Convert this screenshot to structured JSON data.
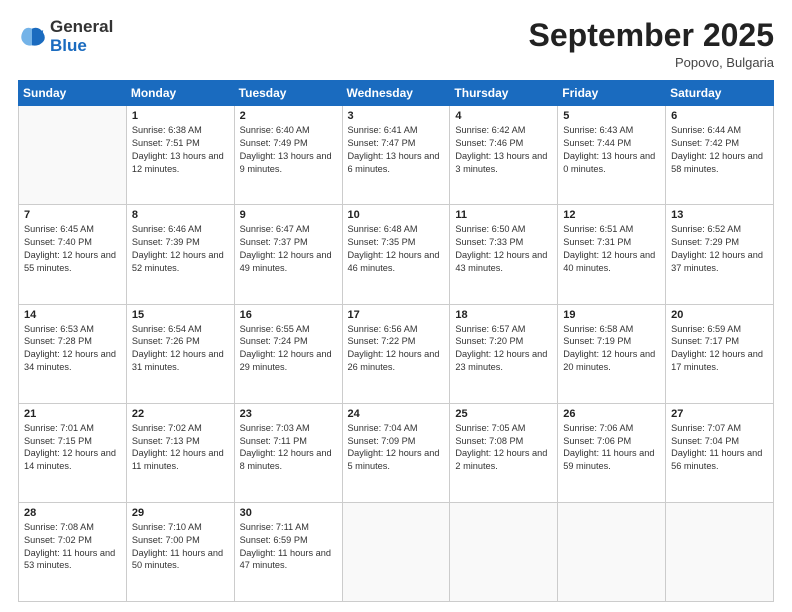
{
  "header": {
    "logo_general": "General",
    "logo_blue": "Blue",
    "month_title": "September 2025",
    "location": "Popovo, Bulgaria"
  },
  "columns": [
    "Sunday",
    "Monday",
    "Tuesday",
    "Wednesday",
    "Thursday",
    "Friday",
    "Saturday"
  ],
  "weeks": [
    [
      {
        "day": "",
        "sunrise": "",
        "sunset": "",
        "daylight": ""
      },
      {
        "day": "1",
        "sunrise": "Sunrise: 6:38 AM",
        "sunset": "Sunset: 7:51 PM",
        "daylight": "Daylight: 13 hours and 12 minutes."
      },
      {
        "day": "2",
        "sunrise": "Sunrise: 6:40 AM",
        "sunset": "Sunset: 7:49 PM",
        "daylight": "Daylight: 13 hours and 9 minutes."
      },
      {
        "day": "3",
        "sunrise": "Sunrise: 6:41 AM",
        "sunset": "Sunset: 7:47 PM",
        "daylight": "Daylight: 13 hours and 6 minutes."
      },
      {
        "day": "4",
        "sunrise": "Sunrise: 6:42 AM",
        "sunset": "Sunset: 7:46 PM",
        "daylight": "Daylight: 13 hours and 3 minutes."
      },
      {
        "day": "5",
        "sunrise": "Sunrise: 6:43 AM",
        "sunset": "Sunset: 7:44 PM",
        "daylight": "Daylight: 13 hours and 0 minutes."
      },
      {
        "day": "6",
        "sunrise": "Sunrise: 6:44 AM",
        "sunset": "Sunset: 7:42 PM",
        "daylight": "Daylight: 12 hours and 58 minutes."
      }
    ],
    [
      {
        "day": "7",
        "sunrise": "Sunrise: 6:45 AM",
        "sunset": "Sunset: 7:40 PM",
        "daylight": "Daylight: 12 hours and 55 minutes."
      },
      {
        "day": "8",
        "sunrise": "Sunrise: 6:46 AM",
        "sunset": "Sunset: 7:39 PM",
        "daylight": "Daylight: 12 hours and 52 minutes."
      },
      {
        "day": "9",
        "sunrise": "Sunrise: 6:47 AM",
        "sunset": "Sunset: 7:37 PM",
        "daylight": "Daylight: 12 hours and 49 minutes."
      },
      {
        "day": "10",
        "sunrise": "Sunrise: 6:48 AM",
        "sunset": "Sunset: 7:35 PM",
        "daylight": "Daylight: 12 hours and 46 minutes."
      },
      {
        "day": "11",
        "sunrise": "Sunrise: 6:50 AM",
        "sunset": "Sunset: 7:33 PM",
        "daylight": "Daylight: 12 hours and 43 minutes."
      },
      {
        "day": "12",
        "sunrise": "Sunrise: 6:51 AM",
        "sunset": "Sunset: 7:31 PM",
        "daylight": "Daylight: 12 hours and 40 minutes."
      },
      {
        "day": "13",
        "sunrise": "Sunrise: 6:52 AM",
        "sunset": "Sunset: 7:29 PM",
        "daylight": "Daylight: 12 hours and 37 minutes."
      }
    ],
    [
      {
        "day": "14",
        "sunrise": "Sunrise: 6:53 AM",
        "sunset": "Sunset: 7:28 PM",
        "daylight": "Daylight: 12 hours and 34 minutes."
      },
      {
        "day": "15",
        "sunrise": "Sunrise: 6:54 AM",
        "sunset": "Sunset: 7:26 PM",
        "daylight": "Daylight: 12 hours and 31 minutes."
      },
      {
        "day": "16",
        "sunrise": "Sunrise: 6:55 AM",
        "sunset": "Sunset: 7:24 PM",
        "daylight": "Daylight: 12 hours and 29 minutes."
      },
      {
        "day": "17",
        "sunrise": "Sunrise: 6:56 AM",
        "sunset": "Sunset: 7:22 PM",
        "daylight": "Daylight: 12 hours and 26 minutes."
      },
      {
        "day": "18",
        "sunrise": "Sunrise: 6:57 AM",
        "sunset": "Sunset: 7:20 PM",
        "daylight": "Daylight: 12 hours and 23 minutes."
      },
      {
        "day": "19",
        "sunrise": "Sunrise: 6:58 AM",
        "sunset": "Sunset: 7:19 PM",
        "daylight": "Daylight: 12 hours and 20 minutes."
      },
      {
        "day": "20",
        "sunrise": "Sunrise: 6:59 AM",
        "sunset": "Sunset: 7:17 PM",
        "daylight": "Daylight: 12 hours and 17 minutes."
      }
    ],
    [
      {
        "day": "21",
        "sunrise": "Sunrise: 7:01 AM",
        "sunset": "Sunset: 7:15 PM",
        "daylight": "Daylight: 12 hours and 14 minutes."
      },
      {
        "day": "22",
        "sunrise": "Sunrise: 7:02 AM",
        "sunset": "Sunset: 7:13 PM",
        "daylight": "Daylight: 12 hours and 11 minutes."
      },
      {
        "day": "23",
        "sunrise": "Sunrise: 7:03 AM",
        "sunset": "Sunset: 7:11 PM",
        "daylight": "Daylight: 12 hours and 8 minutes."
      },
      {
        "day": "24",
        "sunrise": "Sunrise: 7:04 AM",
        "sunset": "Sunset: 7:09 PM",
        "daylight": "Daylight: 12 hours and 5 minutes."
      },
      {
        "day": "25",
        "sunrise": "Sunrise: 7:05 AM",
        "sunset": "Sunset: 7:08 PM",
        "daylight": "Daylight: 12 hours and 2 minutes."
      },
      {
        "day": "26",
        "sunrise": "Sunrise: 7:06 AM",
        "sunset": "Sunset: 7:06 PM",
        "daylight": "Daylight: 11 hours and 59 minutes."
      },
      {
        "day": "27",
        "sunrise": "Sunrise: 7:07 AM",
        "sunset": "Sunset: 7:04 PM",
        "daylight": "Daylight: 11 hours and 56 minutes."
      }
    ],
    [
      {
        "day": "28",
        "sunrise": "Sunrise: 7:08 AM",
        "sunset": "Sunset: 7:02 PM",
        "daylight": "Daylight: 11 hours and 53 minutes."
      },
      {
        "day": "29",
        "sunrise": "Sunrise: 7:10 AM",
        "sunset": "Sunset: 7:00 PM",
        "daylight": "Daylight: 11 hours and 50 minutes."
      },
      {
        "day": "30",
        "sunrise": "Sunrise: 7:11 AM",
        "sunset": "Sunset: 6:59 PM",
        "daylight": "Daylight: 11 hours and 47 minutes."
      },
      {
        "day": "",
        "sunrise": "",
        "sunset": "",
        "daylight": ""
      },
      {
        "day": "",
        "sunrise": "",
        "sunset": "",
        "daylight": ""
      },
      {
        "day": "",
        "sunrise": "",
        "sunset": "",
        "daylight": ""
      },
      {
        "day": "",
        "sunrise": "",
        "sunset": "",
        "daylight": ""
      }
    ]
  ]
}
